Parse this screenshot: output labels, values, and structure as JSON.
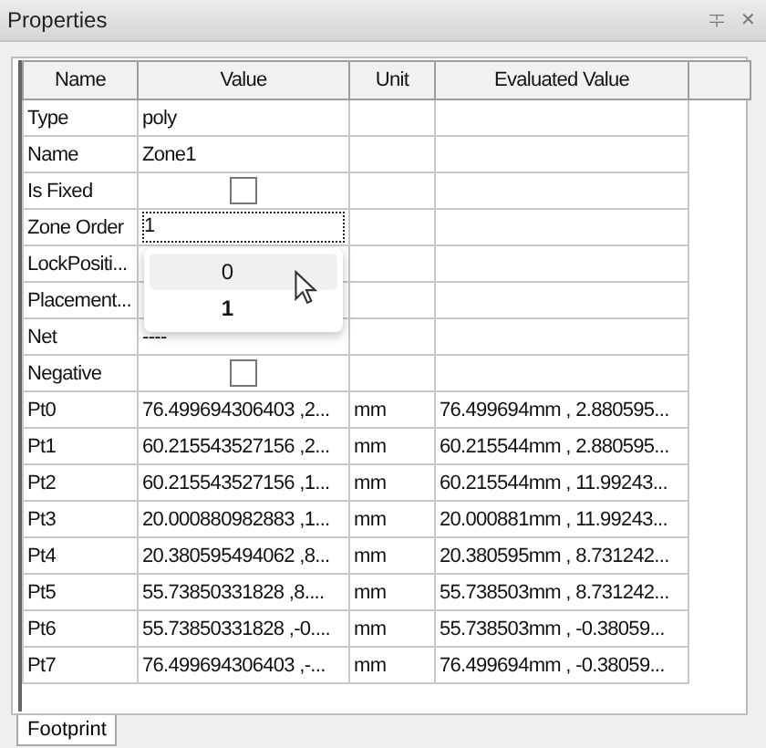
{
  "window": {
    "title": "Properties",
    "buttons": [
      "ᆍ",
      "✕"
    ]
  },
  "table": {
    "columns": [
      "Name",
      "Value",
      "Unit",
      "Evaluated Value"
    ],
    "rows": [
      {
        "kind": "text",
        "name": "Type",
        "value": "poly"
      },
      {
        "kind": "text",
        "name": "Name",
        "value": "Zone1"
      },
      {
        "kind": "checkbox",
        "name": "Is Fixed",
        "checked": false
      },
      {
        "kind": "edit",
        "name": "Zone Order",
        "value": "1"
      },
      {
        "kind": "text",
        "name": "LockPositi..."
      },
      {
        "kind": "text",
        "name": "Placement..."
      },
      {
        "kind": "text",
        "name": "Net",
        "value": "----"
      },
      {
        "kind": "checkbox",
        "name": "Negative",
        "checked": false
      },
      {
        "kind": "text",
        "name": "Pt0",
        "value": "76.499694306403 ,2...",
        "unit": "mm",
        "evaluated": "76.499694mm , 2.880595..."
      },
      {
        "kind": "text",
        "name": "Pt1",
        "value": "60.215543527156 ,2...",
        "unit": "mm",
        "evaluated": "60.215544mm , 2.880595..."
      },
      {
        "kind": "text",
        "name": "Pt2",
        "value": "60.215543527156 ,1...",
        "unit": "mm",
        "evaluated": "60.215544mm , 11.99243..."
      },
      {
        "kind": "text",
        "name": "Pt3",
        "value": "20.000880982883 ,1...",
        "unit": "mm",
        "evaluated": "20.000881mm , 11.99243..."
      },
      {
        "kind": "text",
        "name": "Pt4",
        "value": "20.380595494062 ,8...",
        "unit": "mm",
        "evaluated": "20.380595mm , 8.731242..."
      },
      {
        "kind": "text",
        "name": "Pt5",
        "value": "55.73850331828 ,8....",
        "unit": "mm",
        "evaluated": "55.738503mm , 8.731242..."
      },
      {
        "kind": "text",
        "name": "Pt6",
        "value": "55.73850331828 ,-0....",
        "unit": "mm",
        "evaluated": "55.738503mm , -0.38059..."
      },
      {
        "kind": "text",
        "name": "Pt7",
        "value": "76.499694306403 ,-...",
        "unit": "mm",
        "evaluated": "76.499694mm , -0.38059..."
      }
    ]
  },
  "dropdown": {
    "options": [
      {
        "label": "0",
        "hovered": true,
        "selected": false
      },
      {
        "label": "1",
        "hovered": false,
        "selected": true
      }
    ]
  },
  "tabs": [
    {
      "label": "Footprint",
      "selected": true
    }
  ]
}
